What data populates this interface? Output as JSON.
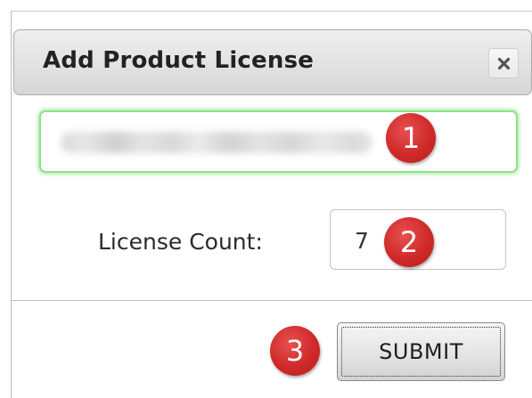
{
  "dialog": {
    "title": "Add Product License",
    "close_icon": "close-icon"
  },
  "product_field": {
    "value": "",
    "value_blurred": true,
    "focused": true,
    "focus_color": "#8fe38a"
  },
  "license_count": {
    "label": "License Count:",
    "value": "7"
  },
  "submit": {
    "label": "SUBMIT"
  },
  "annotations": [
    {
      "number": "1",
      "color": "#cf2a2a"
    },
    {
      "number": "2",
      "color": "#cf2a2a"
    },
    {
      "number": "3",
      "color": "#cf2a2a"
    }
  ]
}
